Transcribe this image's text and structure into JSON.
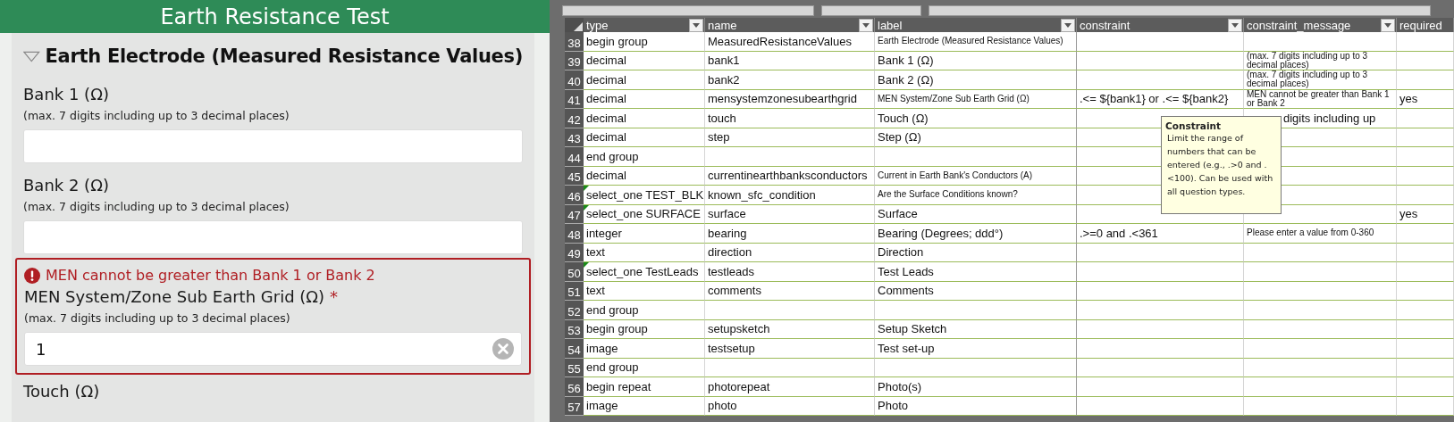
{
  "form": {
    "title": "Earth Resistance Test",
    "section": {
      "title": "Earth Electrode (Measured Resistance Values)",
      "expanded": true
    },
    "fields": [
      {
        "label": "Bank 1 (Ω)",
        "hint": "(max. 7 digits including up to 3 decimal places)",
        "required": false
      },
      {
        "label": "Bank 2 (Ω)",
        "hint": "(max. 7 digits including up to 3 decimal places)",
        "required": false
      },
      {
        "label": "MEN System/Zone Sub Earth Grid (Ω)",
        "hint": "(max. 7 digits including up to 3 decimal places)",
        "required": true,
        "required_mark": "*",
        "error": "MEN cannot be greater than Bank 1 or Bank 2",
        "value": "1"
      }
    ],
    "next_field_label": "Touch (Ω)"
  },
  "sheet": {
    "columns": [
      "type",
      "name",
      "label",
      "constraint",
      "constraint_message",
      "required"
    ],
    "rows": [
      {
        "number": "38",
        "comment": false,
        "cells": [
          "begin group",
          "MeasuredResistanceValues",
          "Earth Electrode (Measured Resistance Values)",
          "",
          "",
          ""
        ]
      },
      {
        "number": "39",
        "comment": false,
        "cells": [
          "decimal",
          "bank1",
          "Bank 1 (Ω)",
          "",
          "(max. 7 digits including up to 3 decimal places)",
          ""
        ]
      },
      {
        "number": "40",
        "comment": false,
        "cells": [
          "decimal",
          "bank2",
          "Bank 2 (Ω)",
          "",
          "(max. 7 digits including up to 3 decimal places)",
          ""
        ]
      },
      {
        "number": "41",
        "comment": false,
        "cells": [
          "decimal",
          "mensystemzonesubearthgrid",
          "MEN System/Zone Sub Earth Grid (Ω)",
          ".<= ${bank1} or .<= ${bank2}",
          "MEN cannot be greater than Bank 1 or Bank 2",
          "yes"
        ]
      },
      {
        "number": "42",
        "comment": false,
        "under_tooltip": true,
        "cells": [
          "decimal",
          "touch",
          "Touch (Ω)",
          "",
          "digits including up",
          ""
        ]
      },
      {
        "number": "43",
        "comment": false,
        "cells": [
          "decimal",
          "step",
          "Step (Ω)",
          "",
          "",
          ""
        ]
      },
      {
        "number": "44",
        "comment": false,
        "cells": [
          "end group",
          "",
          "",
          "",
          "",
          ""
        ]
      },
      {
        "number": "45",
        "comment": false,
        "cells": [
          "decimal",
          "currentinearthbanksconductors",
          "Current in Earth Bank's Conductors (A)",
          "",
          "",
          ""
        ]
      },
      {
        "number": "46",
        "comment": true,
        "cells": [
          "select_one TEST_BLK",
          "known_sfc_condition",
          "Are the Surface Conditions known?",
          "",
          "",
          ""
        ]
      },
      {
        "number": "47",
        "comment": true,
        "cells": [
          "select_one SURFACE",
          "surface",
          "Surface",
          "",
          "",
          "yes"
        ]
      },
      {
        "number": "48",
        "comment": false,
        "cells": [
          "integer",
          "bearing",
          "Bearing (Degrees; ddd°)",
          ".>=0 and .<361",
          "Please enter a value from 0-360",
          ""
        ]
      },
      {
        "number": "49",
        "comment": false,
        "cells": [
          "text",
          "direction",
          "Direction",
          "",
          "",
          ""
        ]
      },
      {
        "number": "50",
        "comment": true,
        "cells": [
          "select_one TestLeads",
          "testleads",
          "Test Leads",
          "",
          "",
          ""
        ]
      },
      {
        "number": "51",
        "comment": false,
        "cells": [
          "text",
          "comments",
          "Comments",
          "",
          "",
          ""
        ]
      },
      {
        "number": "52",
        "comment": false,
        "cells": [
          "end group",
          "",
          "",
          "",
          "",
          ""
        ]
      },
      {
        "number": "53",
        "comment": false,
        "cells": [
          "begin group",
          "setupsketch",
          "Setup Sketch",
          "",
          "",
          ""
        ]
      },
      {
        "number": "54",
        "comment": false,
        "cells": [
          "image",
          "testsetup",
          "Test set-up",
          "",
          "",
          ""
        ]
      },
      {
        "number": "55",
        "comment": false,
        "cells": [
          "end group",
          "",
          "",
          "",
          "",
          ""
        ]
      },
      {
        "number": "56",
        "comment": false,
        "cells": [
          "begin repeat",
          "photorepeat",
          "Photo(s)",
          "",
          "",
          ""
        ]
      },
      {
        "number": "57",
        "comment": false,
        "cells": [
          "image",
          "photo",
          "Photo",
          "",
          "",
          ""
        ]
      }
    ]
  },
  "tooltip": {
    "title": "Constraint",
    "text": "Limit the range of numbers that can be entered (e.g., .>0 and .<100). Can be used with all question types."
  }
}
